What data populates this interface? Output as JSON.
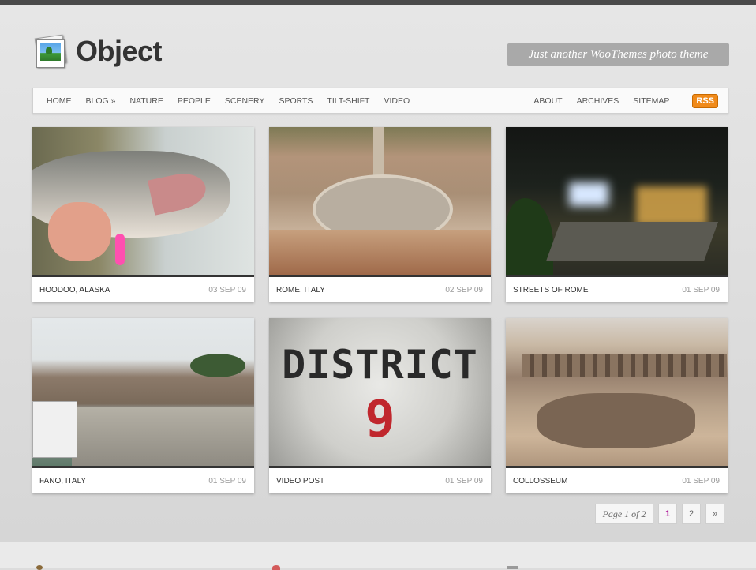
{
  "site": {
    "logo_text": "Object",
    "tagline": "Just another WooThemes photo theme"
  },
  "nav": {
    "left": [
      "HOME",
      "BLOG »",
      "NATURE",
      "PEOPLE",
      "SCENERY",
      "SPORTS",
      "TILT-SHIFT",
      "VIDEO"
    ],
    "right": [
      "ABOUT",
      "ARCHIVES",
      "SITEMAP"
    ],
    "rss_label": "RSS"
  },
  "posts": [
    {
      "title": "HOODOO, ALASKA",
      "date": "03 SEP 09"
    },
    {
      "title": "ROME, ITALY",
      "date": "02 SEP 09"
    },
    {
      "title": "STREETS OF ROME",
      "date": "01 SEP 09"
    },
    {
      "title": "FANO, ITALY",
      "date": "01 SEP 09"
    },
    {
      "title": "VIDEO POST",
      "date": "01 SEP 09"
    },
    {
      "title": "COLLOSSEUM",
      "date": "01 SEP 09"
    }
  ],
  "thumb_text": {
    "district_word": "DISTRICT",
    "district_number": "9"
  },
  "pagination": {
    "label": "Page 1 of 2",
    "pages": [
      "1",
      "2"
    ],
    "current": "1",
    "next": "»"
  },
  "colors": {
    "accent_current_page": "#b0189a",
    "rss": "#f08a1a",
    "tagline_bg": "#a9a9a9"
  }
}
